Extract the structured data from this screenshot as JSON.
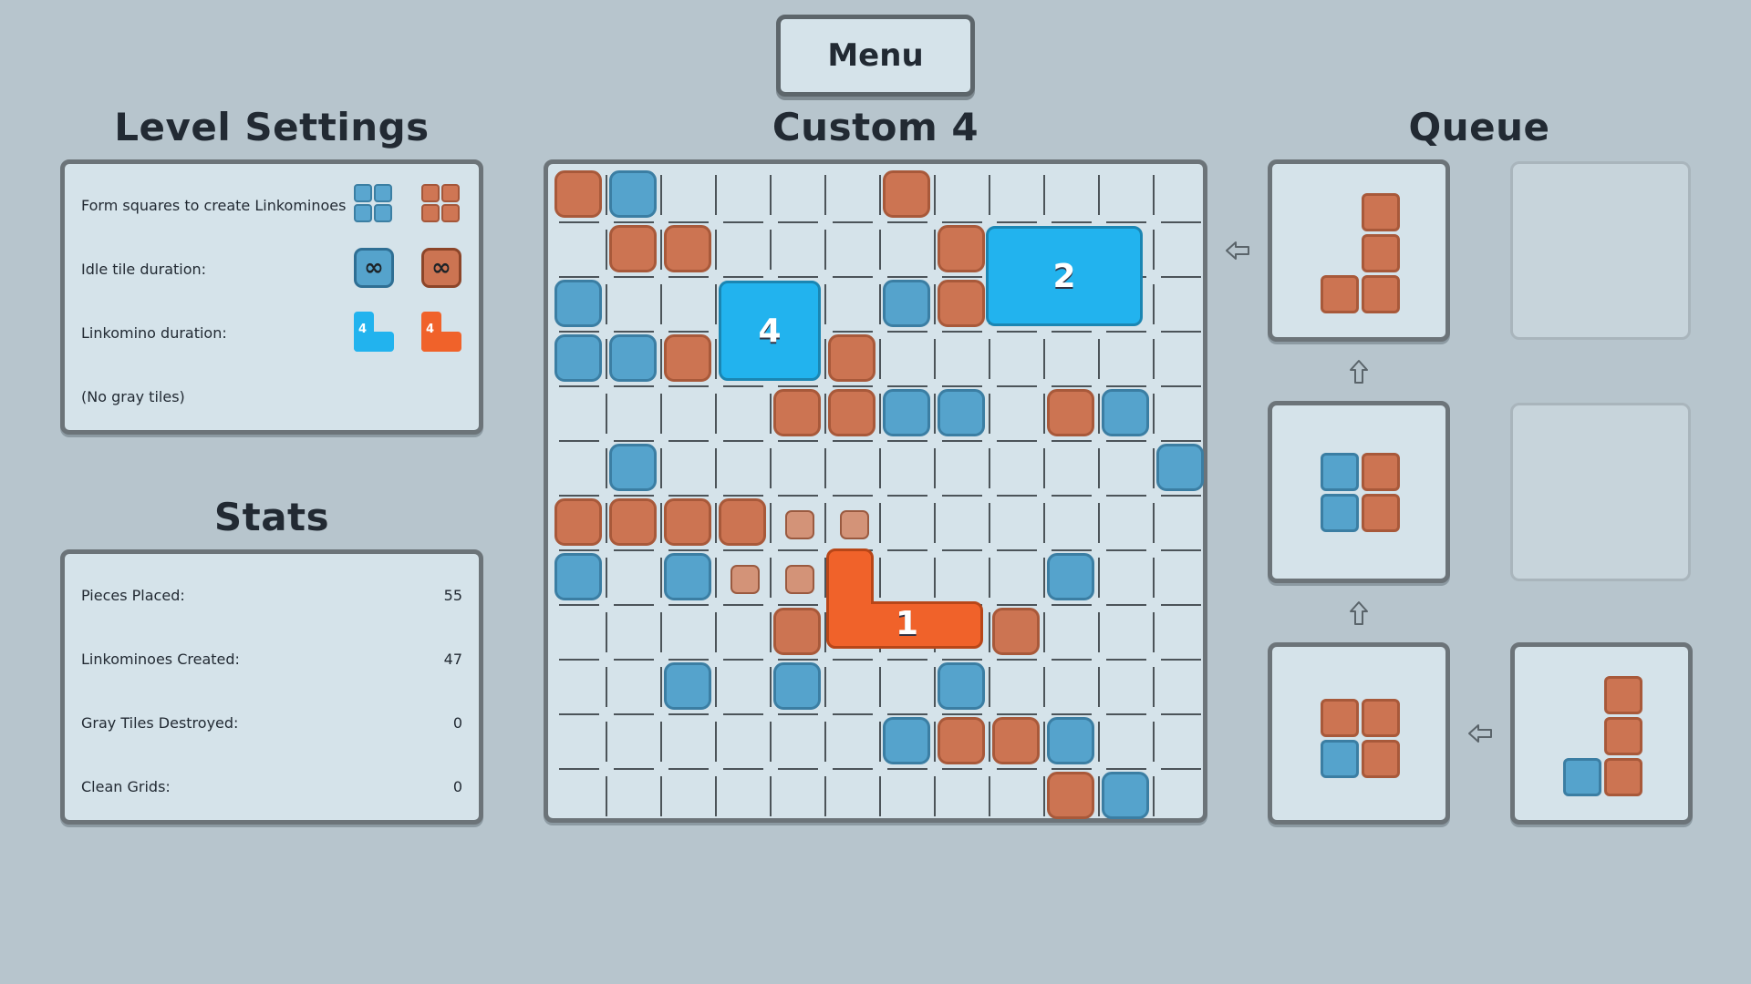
{
  "menu": {
    "label": "Menu"
  },
  "level_title": "Custom 4",
  "level_settings": {
    "heading": "Level Settings",
    "rows": [
      {
        "label": "Form squares to create Linkominoes"
      },
      {
        "label": "Idle tile duration:",
        "blue_icon": "∞",
        "orange_icon": "∞"
      },
      {
        "label": "Linkomino duration:",
        "blue_icon": "4",
        "orange_icon": "4"
      },
      {
        "label": "(No gray tiles)"
      }
    ]
  },
  "stats": {
    "heading": "Stats",
    "rows": [
      {
        "label": "Pieces Placed:",
        "value": "55"
      },
      {
        "label": "Linkominoes Created:",
        "value": "47"
      },
      {
        "label": "Gray Tiles Destroyed:",
        "value": "0"
      },
      {
        "label": "Clean Grids:",
        "value": "0"
      }
    ]
  },
  "queue": {
    "heading": "Queue"
  },
  "board": {
    "cols": 12,
    "rows": 12,
    "tiles": [
      {
        "c": 0,
        "r": 0,
        "color": "orange"
      },
      {
        "c": 1,
        "r": 0,
        "color": "blue"
      },
      {
        "c": 6,
        "r": 0,
        "color": "orange"
      },
      {
        "c": 1,
        "r": 1,
        "color": "orange"
      },
      {
        "c": 2,
        "r": 1,
        "color": "orange"
      },
      {
        "c": 7,
        "r": 1,
        "color": "orange"
      },
      {
        "c": 0,
        "r": 2,
        "color": "blue"
      },
      {
        "c": 6,
        "r": 2,
        "color": "blue"
      },
      {
        "c": 7,
        "r": 2,
        "color": "orange"
      },
      {
        "c": 0,
        "r": 3,
        "color": "blue"
      },
      {
        "c": 1,
        "r": 3,
        "color": "blue"
      },
      {
        "c": 2,
        "r": 3,
        "color": "orange"
      },
      {
        "c": 5,
        "r": 3,
        "color": "orange"
      },
      {
        "c": 4,
        "r": 4,
        "color": "orange"
      },
      {
        "c": 5,
        "r": 4,
        "color": "orange"
      },
      {
        "c": 6,
        "r": 4,
        "color": "blue"
      },
      {
        "c": 7,
        "r": 4,
        "color": "blue"
      },
      {
        "c": 9,
        "r": 4,
        "color": "orange"
      },
      {
        "c": 10,
        "r": 4,
        "color": "blue"
      },
      {
        "c": 1,
        "r": 5,
        "color": "blue"
      },
      {
        "c": 11,
        "r": 5,
        "color": "blue"
      },
      {
        "c": 0,
        "r": 6,
        "color": "orange"
      },
      {
        "c": 1,
        "r": 6,
        "color": "orange"
      },
      {
        "c": 2,
        "r": 6,
        "color": "orange"
      },
      {
        "c": 3,
        "r": 6,
        "color": "orange"
      },
      {
        "c": 4,
        "r": 6,
        "color": "small"
      },
      {
        "c": 5,
        "r": 6,
        "color": "small"
      },
      {
        "c": 0,
        "r": 7,
        "color": "blue"
      },
      {
        "c": 2,
        "r": 7,
        "color": "blue"
      },
      {
        "c": 3,
        "r": 7,
        "color": "small"
      },
      {
        "c": 4,
        "r": 7,
        "color": "small"
      },
      {
        "c": 9,
        "r": 7,
        "color": "blue"
      },
      {
        "c": 4,
        "r": 8,
        "color": "orange"
      },
      {
        "c": 8,
        "r": 8,
        "color": "orange"
      },
      {
        "c": 2,
        "r": 9,
        "color": "blue"
      },
      {
        "c": 4,
        "r": 9,
        "color": "blue"
      },
      {
        "c": 7,
        "r": 9,
        "color": "blue"
      },
      {
        "c": 6,
        "r": 10,
        "color": "blue"
      },
      {
        "c": 7,
        "r": 10,
        "color": "orange"
      },
      {
        "c": 8,
        "r": 10,
        "color": "orange"
      },
      {
        "c": 9,
        "r": 10,
        "color": "blue"
      },
      {
        "c": 9,
        "r": 11,
        "color": "orange"
      },
      {
        "c": 10,
        "r": 11,
        "color": "blue"
      }
    ],
    "linkominoes": [
      {
        "label": "4",
        "color": "blue"
      },
      {
        "label": "2",
        "color": "blue"
      },
      {
        "label": "1",
        "color": "orange"
      }
    ]
  },
  "colors": {
    "background": "#b7c5cd",
    "panel": "#d5e3ea",
    "tile_blue": "#55a3cc",
    "tile_orange": "#cc7452",
    "linkomino_blue": "#22b3ee",
    "linkomino_orange": "#f0622a"
  },
  "icons": [
    "blue-square-icon",
    "orange-square-icon",
    "infinity-icon",
    "l-piece-icon",
    "arrow-left-icon",
    "arrow-up-icon"
  ]
}
